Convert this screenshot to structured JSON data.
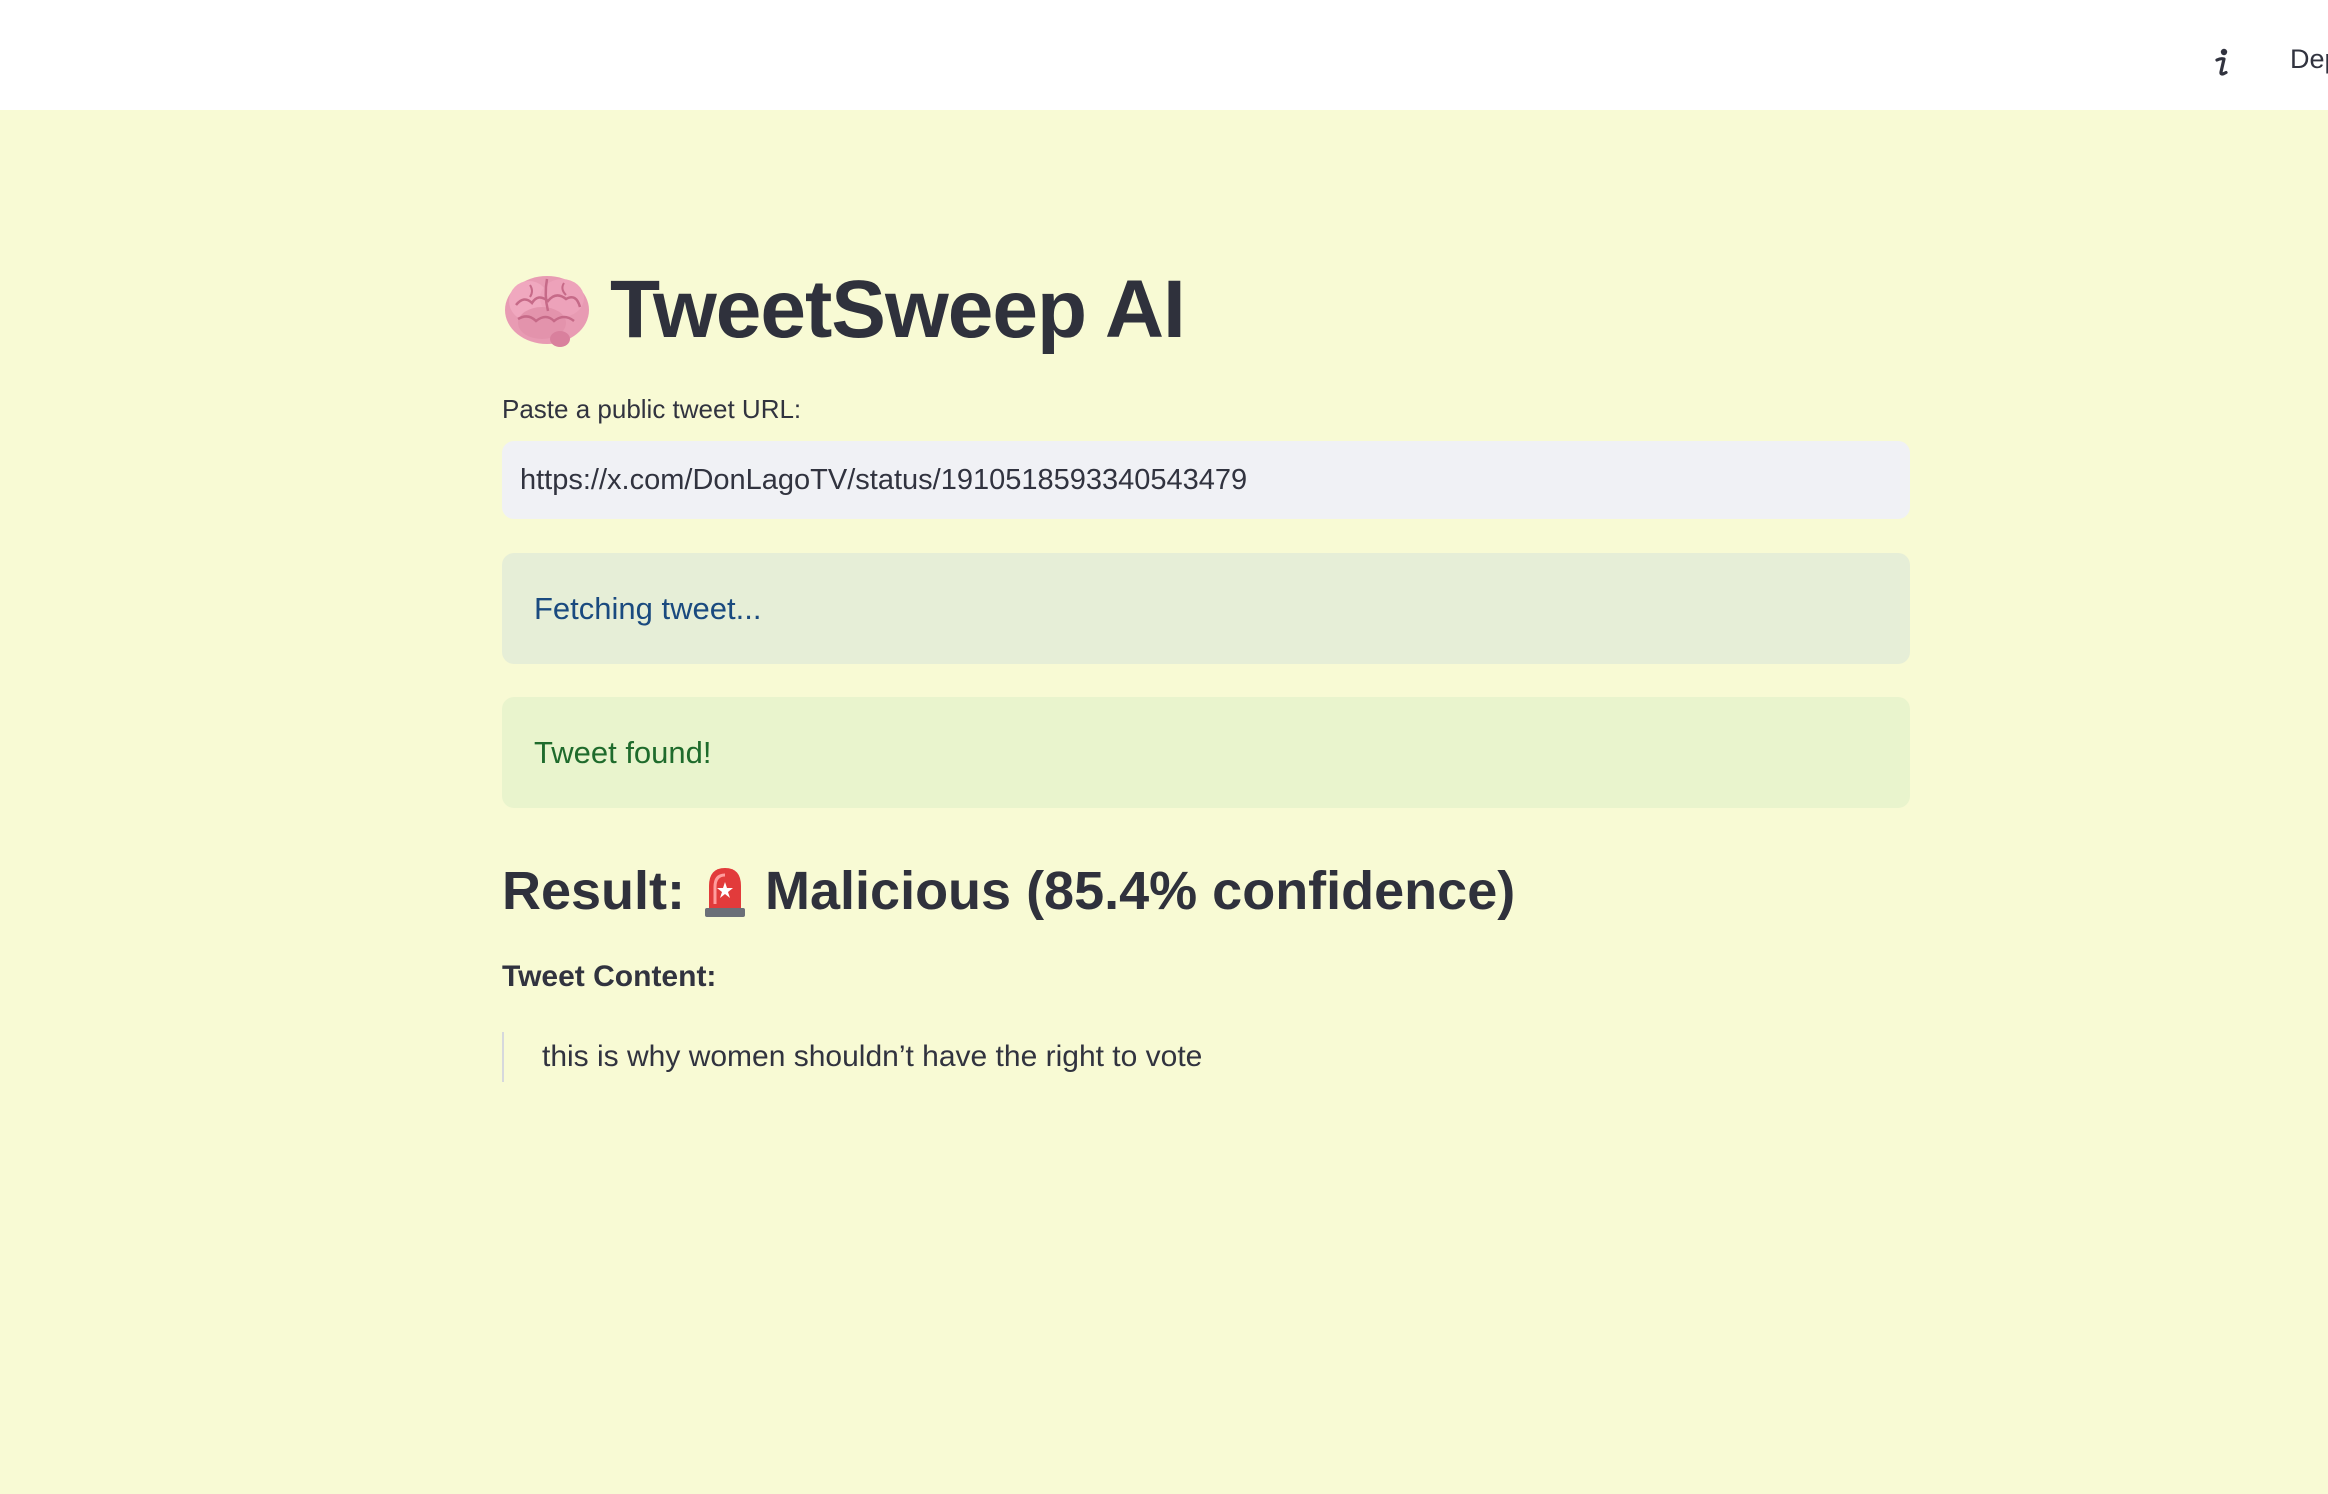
{
  "header": {
    "info_icon": "info-icon",
    "deploy_label": "Deploy"
  },
  "main": {
    "title_icon": "brain-icon",
    "title": "TweetSweep AI",
    "input_label": "Paste a public tweet URL:",
    "input_value": "https://x.com/DonLagoTV/status/1910518593340543479",
    "info_message": "Fetching tweet...",
    "success_message": "Tweet found!",
    "result_prefix": "Result:",
    "result_icon": "siren-icon",
    "result_text": "Malicious (85.4% confidence)",
    "content_label": "Tweet Content:",
    "tweet_text": "this is why women shouldn’t have the right to vote"
  },
  "colors": {
    "background": "#f8fad4",
    "header_bg": "#ffffff",
    "input_bg": "#f0f1f5",
    "info_bg": "#e6eed7",
    "info_text": "#1a4a7f",
    "success_bg": "#e9f4cd",
    "success_text": "#1f6b2c",
    "text": "#31333f"
  }
}
